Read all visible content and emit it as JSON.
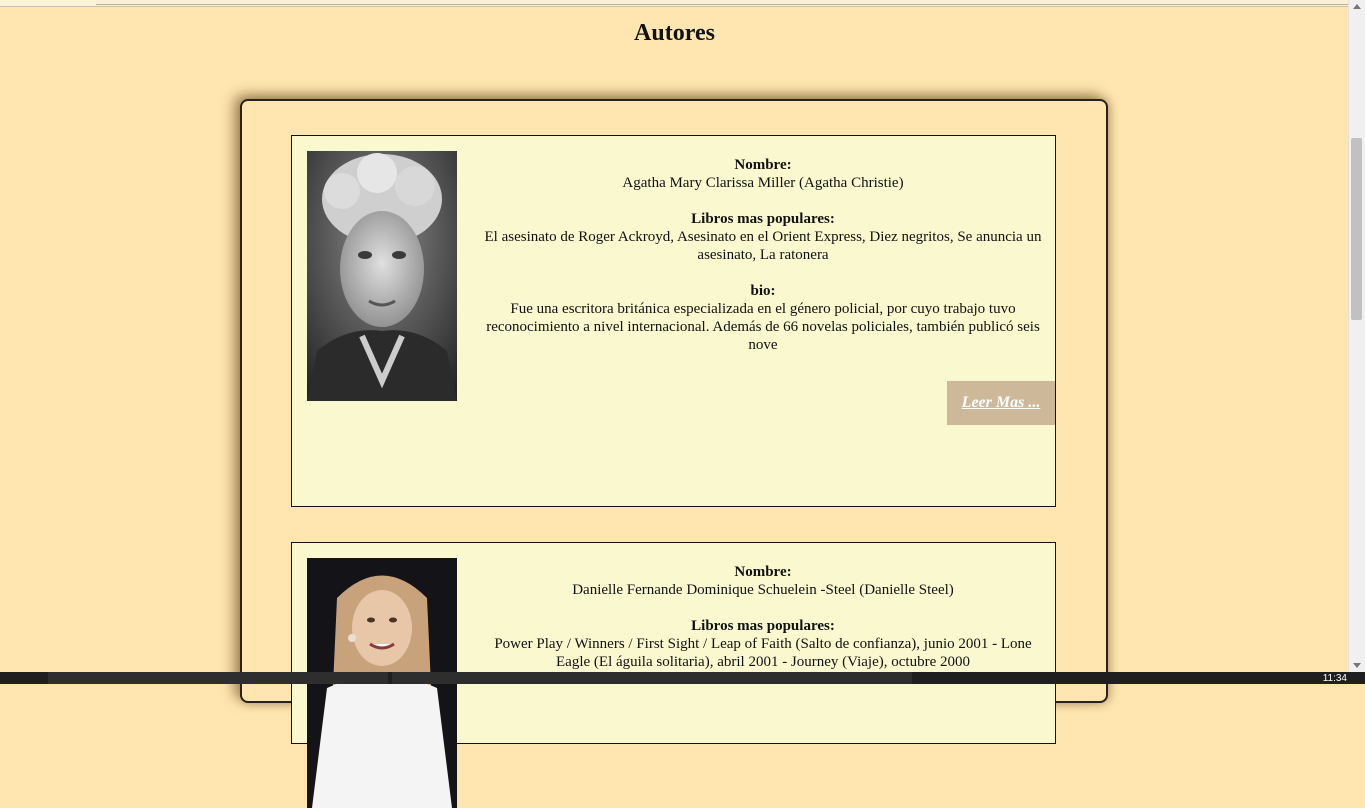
{
  "page": {
    "title": "Autores"
  },
  "authors": [
    {
      "name_label": "Nombre:",
      "name": "Agatha Mary Clarissa Miller (Agatha Christie)",
      "books_label": "Libros mas populares:",
      "books": "El asesinato de Roger Ackroyd, Asesinato en el Orient Express, Diez negritos, Se anuncia un asesinato, La ratonera",
      "bio_label": "bio:",
      "bio": "Fue una escritora británica especializada en el género policial, por cuyo trabajo tuvo reconocimiento a nivel internacional. Además de 66 novelas policiales, también publicó seis nove",
      "read_more": "Leer Mas ..."
    },
    {
      "name_label": "Nombre:",
      "name": "Danielle Fernande Dominique Schuelein -Steel (Danielle Steel)",
      "books_label": "Libros mas populares:",
      "books": "Power Play / Winners / First Sight / Leap of Faith (Salto de confianza), junio 2001 - Lone Eagle (El águila solitaria), abril 2001 - Journey (Viaje), octubre 2000"
    }
  ],
  "taskbar": {
    "clock": "11:34"
  },
  "colors": {
    "background": "#ffe6b0",
    "card": "#f9f8cf",
    "read_more_bg": "#cdb99a"
  }
}
